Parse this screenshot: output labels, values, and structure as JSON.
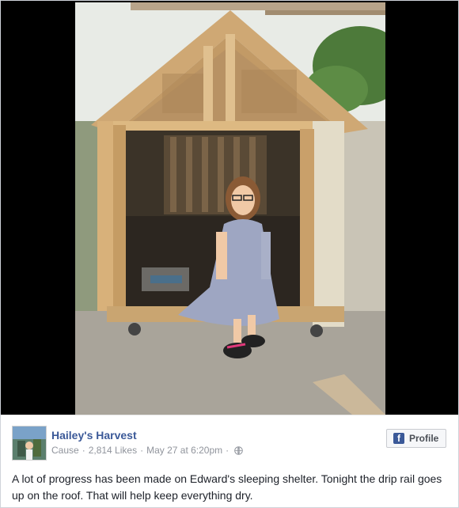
{
  "post": {
    "page_name": "Hailey's Harvest",
    "category": "Cause",
    "likes": "2,814 Likes",
    "date": "May 27 at 6:20pm",
    "separator": "·",
    "privacy_icon": "globe-icon",
    "profile_button_label": "Profile",
    "caption": "A lot of progress has been made on Edward's sleeping shelter. Tonight the drip rail goes up on the roof. That will help keep everything dry."
  },
  "colors": {
    "brand": "#3b5998",
    "meta_text": "#90949c",
    "body_text": "#1d2129"
  }
}
